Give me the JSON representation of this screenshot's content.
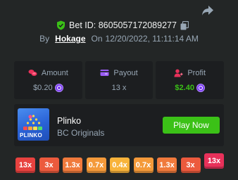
{
  "bet": {
    "bet_id_text": "Bet ID: 8605057172089277",
    "by_label": "By",
    "username": "Hokage",
    "on_label": "On",
    "date": "12/20/2022, 11:11:14 AM"
  },
  "stats": {
    "amount": {
      "label": "Amount",
      "value": "$0.20"
    },
    "payout": {
      "label": "Payout",
      "value": "13 x"
    },
    "profit": {
      "label": "Profit",
      "value": "$2.40"
    }
  },
  "game": {
    "name": "Plinko",
    "provider": "BC Originals",
    "thumb_logo": "PLINKO",
    "play_label": "Play Now"
  },
  "multipliers": [
    {
      "label": "13x",
      "color": "#e8423f",
      "highlighted": false
    },
    {
      "label": "3x",
      "color": "#ec5a3d",
      "highlighted": false
    },
    {
      "label": "1.3x",
      "color": "#f07a3c",
      "highlighted": false
    },
    {
      "label": "0.7x",
      "color": "#f49a3a",
      "highlighted": false
    },
    {
      "label": "0.4x",
      "color": "#f8b33a",
      "highlighted": false
    },
    {
      "label": "0.7x",
      "color": "#f49a3a",
      "highlighted": false
    },
    {
      "label": "1.3x",
      "color": "#f07a3c",
      "highlighted": false
    },
    {
      "label": "3x",
      "color": "#ec5a3d",
      "highlighted": false
    },
    {
      "label": "13x",
      "color": "#e8315a",
      "highlighted": true
    }
  ],
  "colors": {
    "background": "#232626",
    "card": "#1c1e20",
    "accent_green": "#3bc117",
    "muted_text": "#98a7b5"
  },
  "icons": {
    "share": "share-arrow-icon",
    "verified": "shield-check-icon",
    "copy": "copy-icon",
    "amount": "coins-stack-icon",
    "payout": "wallet-card-icon",
    "profit": "profit-user-icon",
    "coin": "bcd-coin-icon"
  }
}
